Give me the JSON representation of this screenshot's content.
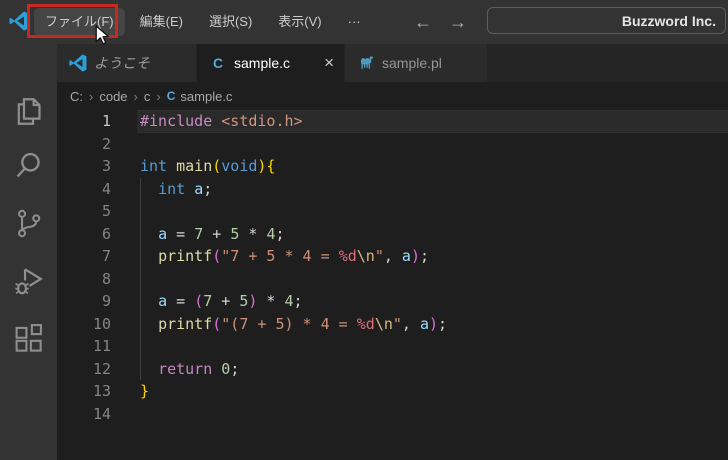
{
  "window": {
    "title": "Buzzword Inc."
  },
  "title_bar": {
    "menus": [
      {
        "id": "file",
        "label": "ファイル(F)",
        "highlighted": true
      },
      {
        "id": "edit",
        "label": "編集(E)"
      },
      {
        "id": "selection",
        "label": "選択(S)"
      },
      {
        "id": "view",
        "label": "表示(V)"
      },
      {
        "id": "more",
        "label": "···"
      }
    ],
    "nav": {
      "back": "←",
      "forward": "→"
    },
    "command_center": {
      "text": "Buzzword Inc."
    }
  },
  "overlay": {
    "highlight_box_color": "#c9281f",
    "highlighted_menu": "ファイル(F)",
    "cursor": "arrow"
  },
  "activity_bar": {
    "items": [
      {
        "id": "explorer",
        "icon": "files-icon"
      },
      {
        "id": "search",
        "icon": "search-icon"
      },
      {
        "id": "source-control",
        "icon": "source-control-icon"
      },
      {
        "id": "run-debug",
        "icon": "debug-icon"
      },
      {
        "id": "extensions",
        "icon": "extensions-icon"
      }
    ]
  },
  "tab_bar": {
    "tabs": [
      {
        "id": "welcome",
        "label": "ようこそ",
        "icon": "vscode-logo",
        "state": "preview"
      },
      {
        "id": "sample-c",
        "label": "sample.c",
        "icon": "c-file",
        "state": "active",
        "close_label": "×"
      },
      {
        "id": "sample-pl",
        "label": "sample.pl",
        "icon": "perl-file",
        "state": "inactive"
      }
    ]
  },
  "breadcrumb": {
    "separator": "›",
    "segments": [
      {
        "label": "C:"
      },
      {
        "label": "code"
      },
      {
        "label": "c"
      },
      {
        "label": "sample.c",
        "icon": "c-file"
      }
    ]
  },
  "editor": {
    "language": "c",
    "lines": [
      {
        "num": "1",
        "current": true,
        "tokens": [
          [
            "d",
            "#include"
          ],
          [
            "p",
            " "
          ],
          [
            "s",
            "<stdio.h>"
          ]
        ]
      },
      {
        "num": "2",
        "tokens": []
      },
      {
        "num": "3",
        "tokens": [
          [
            "k",
            "int"
          ],
          [
            "p",
            " "
          ],
          [
            "f",
            "main"
          ],
          [
            "b1",
            "("
          ],
          [
            "k",
            "void"
          ],
          [
            "b1",
            "){"
          ]
        ]
      },
      {
        "num": "4",
        "tokens": [
          [
            "p",
            "  "
          ],
          [
            "k",
            "int"
          ],
          [
            "p",
            " "
          ],
          [
            "v",
            "a"
          ],
          [
            "p",
            ";"
          ]
        ]
      },
      {
        "num": "5",
        "tokens": []
      },
      {
        "num": "6",
        "tokens": [
          [
            "p",
            "  "
          ],
          [
            "v",
            "a"
          ],
          [
            "p",
            " = "
          ],
          [
            "n",
            "7"
          ],
          [
            "p",
            " + "
          ],
          [
            "n",
            "5"
          ],
          [
            "p",
            " * "
          ],
          [
            "n",
            "4"
          ],
          [
            "p",
            ";"
          ]
        ]
      },
      {
        "num": "7",
        "tokens": [
          [
            "p",
            "  "
          ],
          [
            "f",
            "printf"
          ],
          [
            "b2",
            "("
          ],
          [
            "s",
            "\"7 + 5 * 4 = "
          ],
          [
            "m",
            "%d"
          ],
          [
            "e",
            "\\n"
          ],
          [
            "s",
            "\""
          ],
          [
            "p",
            ", "
          ],
          [
            "v",
            "a"
          ],
          [
            "b2",
            ")"
          ],
          [
            "p",
            ";"
          ]
        ]
      },
      {
        "num": "8",
        "tokens": []
      },
      {
        "num": "9",
        "tokens": [
          [
            "p",
            "  "
          ],
          [
            "v",
            "a"
          ],
          [
            "p",
            " = "
          ],
          [
            "b2",
            "("
          ],
          [
            "n",
            "7"
          ],
          [
            "p",
            " + "
          ],
          [
            "n",
            "5"
          ],
          [
            "b2",
            ")"
          ],
          [
            "p",
            " * "
          ],
          [
            "n",
            "4"
          ],
          [
            "p",
            ";"
          ]
        ]
      },
      {
        "num": "10",
        "tokens": [
          [
            "p",
            "  "
          ],
          [
            "f",
            "printf"
          ],
          [
            "b2",
            "("
          ],
          [
            "s",
            "\"(7 + 5) * 4 = "
          ],
          [
            "m",
            "%d"
          ],
          [
            "e",
            "\\n"
          ],
          [
            "s",
            "\""
          ],
          [
            "p",
            ", "
          ],
          [
            "v",
            "a"
          ],
          [
            "b2",
            ")"
          ],
          [
            "p",
            ";"
          ]
        ]
      },
      {
        "num": "11",
        "tokens": []
      },
      {
        "num": "12",
        "tokens": [
          [
            "p",
            "  "
          ],
          [
            "d",
            "return"
          ],
          [
            "p",
            " "
          ],
          [
            "n",
            "0"
          ],
          [
            "p",
            ";"
          ]
        ]
      },
      {
        "num": "13",
        "tokens": [
          [
            "b1",
            "}"
          ]
        ]
      },
      {
        "num": "14",
        "tokens": []
      }
    ]
  },
  "colors": {
    "titlebar_bg": "#333333",
    "activitybar_bg": "#333333",
    "tabbar_bg": "#252526",
    "tab_inactive_bg": "#2b2b2b",
    "editor_bg": "#1e1e1e",
    "active_tab_text": "#ffffff",
    "inactive_tab_text": "#969696",
    "line_number": "#858585",
    "line_number_active": "#c6c6c6",
    "breadcrumb_text": "#a9a9a9",
    "menu_text": "#cccccc",
    "file_icon_blue": "#53a9d8",
    "highlight_box": "#c9281f",
    "syntax": {
      "directive": "#c586c0",
      "keyword": "#569cd6",
      "function": "#dcdcaa",
      "variable": "#9cdcfe",
      "number": "#b5cea8",
      "string": "#ce9178",
      "escape": "#d7ba7d",
      "format_specifier": "#e06c75",
      "plain": "#d4d4d4",
      "bracket_level1": "#ffd700",
      "bracket_level2": "#da70d6"
    }
  }
}
